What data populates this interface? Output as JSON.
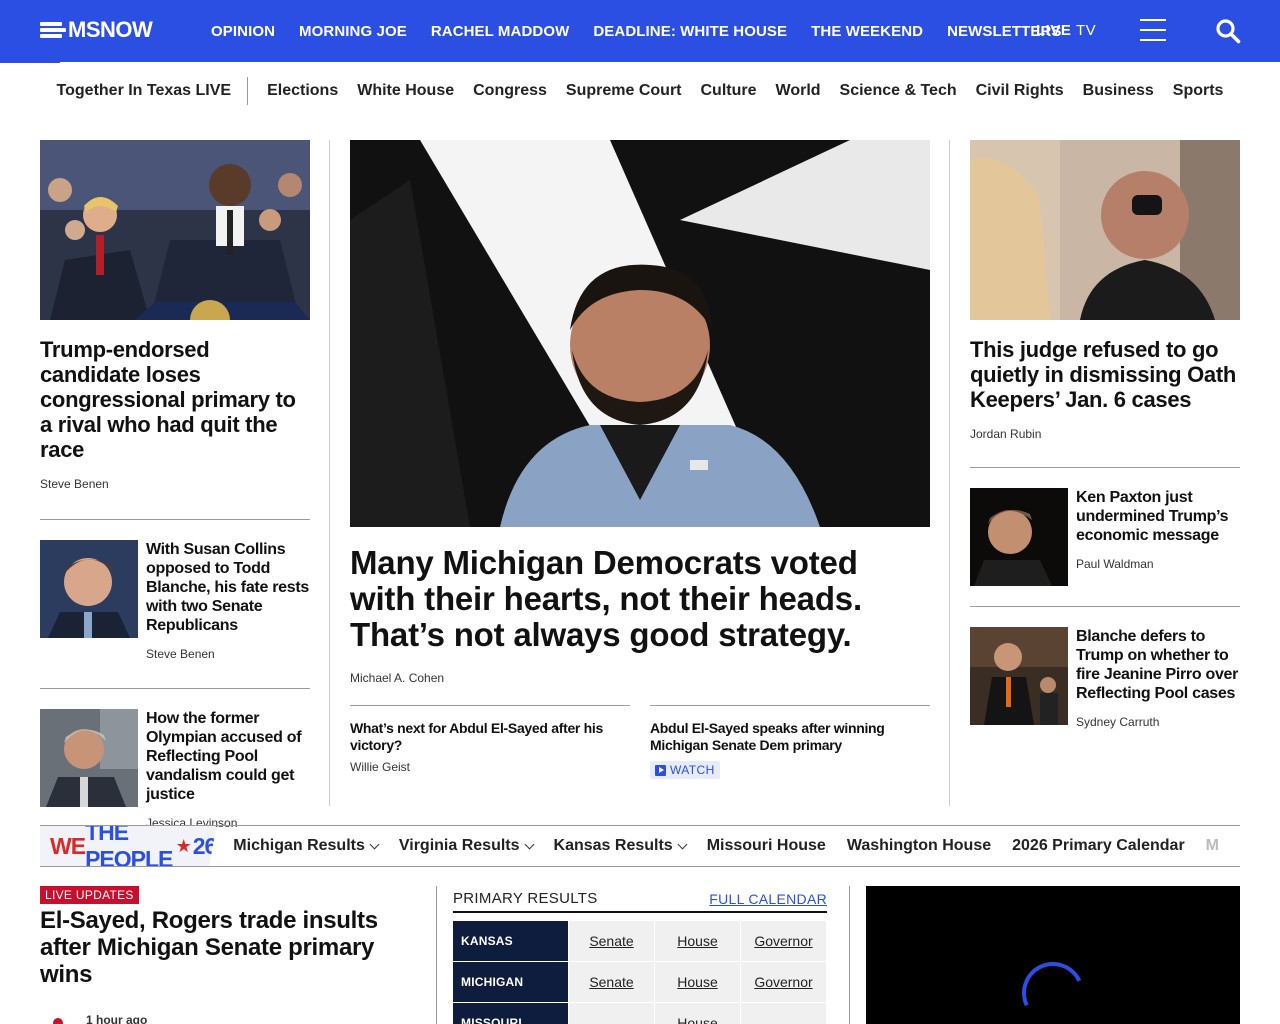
{
  "brand": {
    "logo_main": "MS",
    "logo_now": "NOW"
  },
  "nav": {
    "links": [
      "OPINION",
      "MORNING JOE",
      "RACHEL MADDOW",
      "DEADLINE: WHITE HOUSE",
      "THE WEEKEND",
      "NEWSLETTERS"
    ],
    "live_prefix": "LIVE",
    "live_suffix": "TV"
  },
  "subnav": {
    "featured": "Together In Texas LIVE",
    "items": [
      "Elections",
      "White House",
      "Congress",
      "Supreme Court",
      "Culture",
      "World",
      "Science & Tech",
      "Civil Rights",
      "Business",
      "Sports"
    ]
  },
  "left": {
    "top_story": {
      "headline": "Trump-endorsed candidate loses congressional primary to a rival who had quit the race",
      "byline": "Steve Benen"
    },
    "stories": [
      {
        "headline": "With Susan Collins opposed to Todd Blanche, his fate rests with two Senate Republicans",
        "byline": "Steve Benen"
      },
      {
        "headline": "How the former Olympian accused of Reflecting Pool vandalism could get justice",
        "byline": "Jessica Levinson"
      }
    ]
  },
  "lead": {
    "headline": "Many Michigan Democrats voted with their hearts, not their heads. That’s not always good strategy.",
    "byline": "Michael A. Cohen",
    "sub_stories": [
      {
        "headline": "What’s next for Abdul El-Sayed after his victory?",
        "byline": "Willie Geist"
      },
      {
        "headline": "Abdul El-Sayed speaks after winning Michigan Senate Dem primary",
        "watch_label": "WATCH"
      }
    ]
  },
  "right": {
    "top_story": {
      "headline": "This judge refused to go quietly in dismissing Oath Keepers’ Jan. 6 cases",
      "byline": "Jordan Rubin"
    },
    "stories": [
      {
        "headline": "Ken Paxton just undermined Trump’s economic message",
        "byline": "Paul Waldman"
      },
      {
        "headline": "Blanche defers to Trump on whether to fire Jeanine Pirro over Reflecting Pool cases",
        "byline": "Sydney Carruth"
      }
    ]
  },
  "wtp": {
    "logo_we": "WE",
    "logo_the_people": "THE PEOPLE",
    "logo_star": "★",
    "logo_year": "26",
    "links": [
      {
        "label": "Michigan Results",
        "dropdown": true
      },
      {
        "label": "Virginia Results",
        "dropdown": true
      },
      {
        "label": "Kansas Results",
        "dropdown": true
      },
      {
        "label": "Missouri House",
        "dropdown": false
      },
      {
        "label": "Washington House",
        "dropdown": false
      },
      {
        "label": "2026 Primary Calendar",
        "dropdown": false
      }
    ],
    "overflow_text": "M"
  },
  "live": {
    "badge": "LIVE UPDATES",
    "headline": "El-Sayed, Rogers trade insults after Michigan Senate primary wins",
    "time": "1 hour ago"
  },
  "primary": {
    "title": "PRIMARY RESULTS",
    "calendar_link": "FULL CALENDAR",
    "rows": [
      {
        "state": "KANSAS",
        "senate": "Senate",
        "house": "House",
        "governor": "Governor"
      },
      {
        "state": "MICHIGAN",
        "senate": "Senate",
        "house": "House",
        "governor": "Governor"
      },
      {
        "state": "MISSOURI",
        "senate": "",
        "house": "House",
        "governor": ""
      }
    ]
  },
  "colors": {
    "brand_blue": "#2c4fe3",
    "live_red": "#c8102e",
    "navy": "#0e1d3e"
  }
}
